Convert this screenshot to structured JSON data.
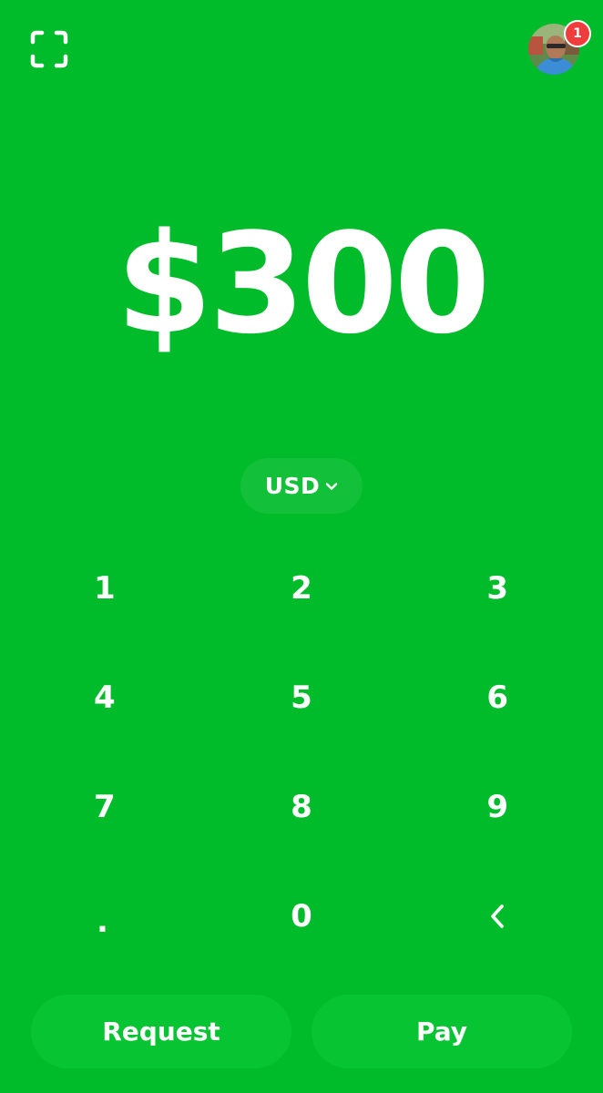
{
  "colors": {
    "background": "#00bc2a",
    "button": "#07c432",
    "badge": "#ef3d3d",
    "text": "#ffffff"
  },
  "header": {
    "scan_icon": "qr-scan-icon",
    "avatar_icon": "profile-avatar",
    "notification_count": "1"
  },
  "amount": {
    "display": "$300"
  },
  "currency": {
    "label": "USD",
    "icon": "chevron-down-icon"
  },
  "keypad": {
    "keys": [
      "1",
      "2",
      "3",
      "4",
      "5",
      "6",
      "7",
      "8",
      "9",
      ".",
      "0"
    ],
    "backspace_icon": "backspace-chevron-left-icon"
  },
  "actions": {
    "request_label": "Request",
    "pay_label": "Pay"
  }
}
